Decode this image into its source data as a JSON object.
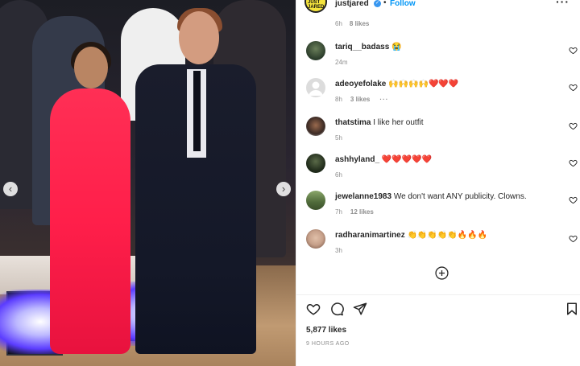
{
  "post": {
    "account": "justjared",
    "follow_label": "Follow",
    "dot": "•",
    "more": "···",
    "avatar_text": "JUST JARED",
    "prev_meta_time": "6h",
    "prev_meta_likes": "8 likes"
  },
  "carousel": {
    "prev": "‹",
    "next": "›"
  },
  "comments": [
    {
      "user": "tariq__badass",
      "text": "😭",
      "time": "24m",
      "likes": "",
      "avatar_color": "#2a3b2a"
    },
    {
      "user": "adeoyefolake",
      "text": "🙌🙌🙌🙌❤️❤️❤️",
      "time": "8h",
      "likes": "3 likes",
      "more": "···",
      "avatar_color": "#d8d8d8"
    },
    {
      "user": "thatstima",
      "text": "I like her outfit",
      "time": "5h",
      "likes": "",
      "avatar_color": "#3b2a24"
    },
    {
      "user": "ashhyland_",
      "text": "❤️❤️❤️❤️❤️",
      "time": "6h",
      "likes": "",
      "avatar_color": "#1f2a1a"
    },
    {
      "user": "jewelanne1983",
      "text": "We don't want ANY publicity. Clowns.",
      "time": "7h",
      "likes": "12 likes",
      "avatar_color": "#4f6a3a"
    },
    {
      "user": "radharanimartinez",
      "text": "👏👏👏👏👏🔥🔥🔥",
      "time": "3h",
      "likes": "",
      "avatar_color": "#c6a08a"
    }
  ],
  "footer": {
    "likes": "5,877 likes",
    "time": "9 HOURS AGO"
  },
  "colors": {
    "link": "#0095f6",
    "muted": "#8e8e8e",
    "text": "#262626"
  }
}
